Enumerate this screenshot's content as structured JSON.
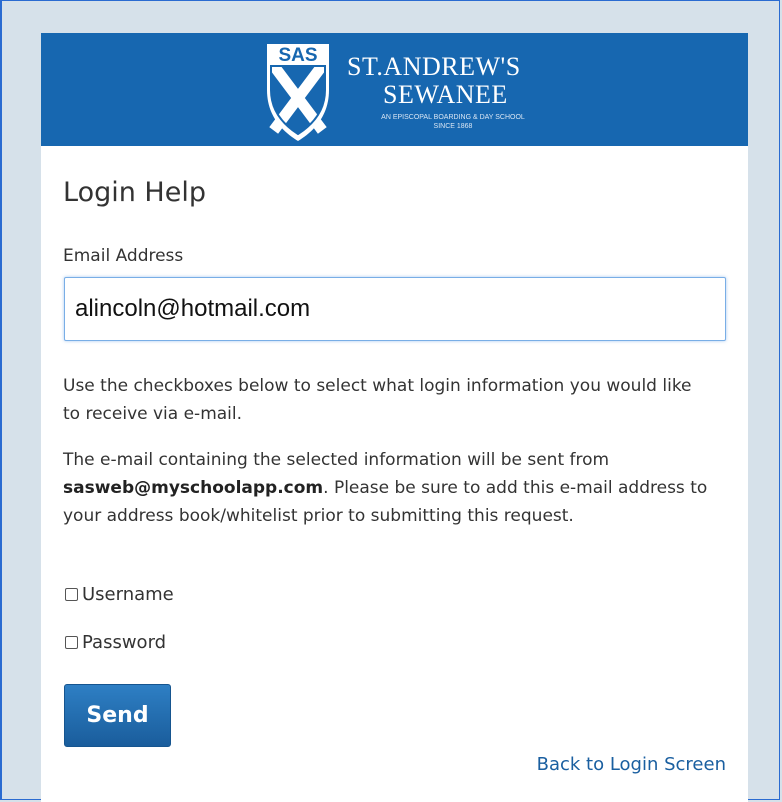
{
  "brand": {
    "logo_text": "SAS",
    "name_line1": "ST.ANDREW'S",
    "name_line2": "SEWANEE",
    "tagline": "AN EPISCOPAL BOARDING & DAY SCHOOL SINCE 1868",
    "banner_color": "#1767b0"
  },
  "page": {
    "title": "Login Help"
  },
  "form": {
    "email_label": "Email Address",
    "email_value": "alincoln@hotmail.com",
    "instructions": "Use the checkboxes below to select what login information you would like to receive via e-mail.",
    "notice_prefix": "The e-mail containing the selected information will be sent from ",
    "notice_email": "sasweb@myschoolapp.com",
    "notice_suffix": ". Please be sure to add this e-mail address to your address book/whitelist prior to submitting this request.",
    "options": [
      {
        "label": "Username",
        "checked": false
      },
      {
        "label": "Password",
        "checked": false
      }
    ],
    "send_label": "Send",
    "back_link": "Back to Login Screen"
  }
}
